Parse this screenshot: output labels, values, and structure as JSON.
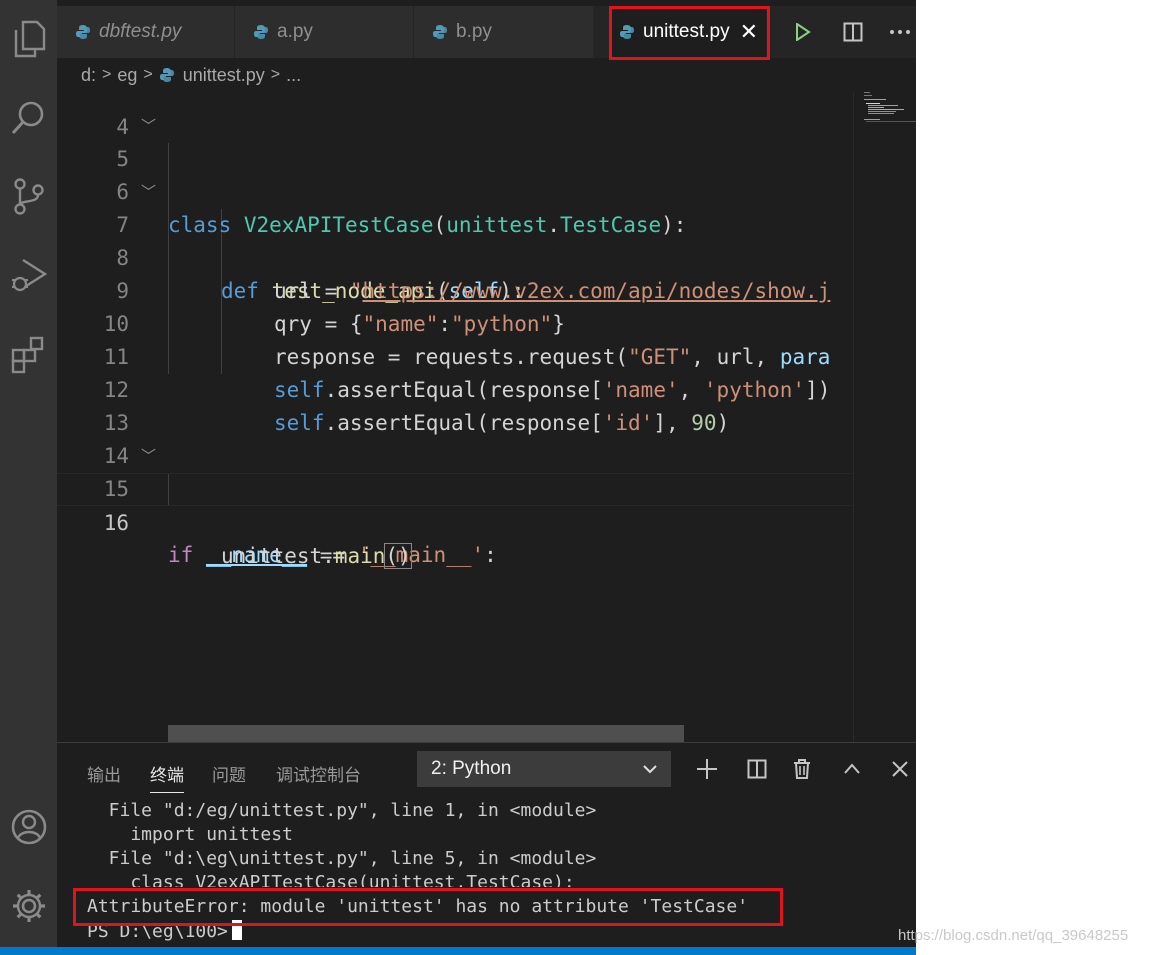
{
  "tabs": [
    {
      "label": "dbftest.py",
      "italic": true
    },
    {
      "label": "a.py",
      "italic": false
    },
    {
      "label": "b.py",
      "italic": false
    },
    {
      "label": "unittest.py",
      "italic": false,
      "active": true
    }
  ],
  "tab_close_glyph": "✕",
  "breadcrumb": {
    "drive": "d:",
    "folder": "eg",
    "file": "unittest.py",
    "more": "..."
  },
  "editor": {
    "partial_line_number": "4",
    "lines": [
      {
        "n": "5"
      },
      {
        "n": "6"
      },
      {
        "n": "7"
      },
      {
        "n": "8"
      },
      {
        "n": "9"
      },
      {
        "n": "10"
      },
      {
        "n": "11"
      },
      {
        "n": "12"
      },
      {
        "n": "13"
      },
      {
        "n": "14"
      },
      {
        "n": "15"
      },
      {
        "n": "16"
      }
    ],
    "code": {
      "l5": [
        "class",
        "V2exAPITestCase",
        "(",
        "unittest",
        ".",
        "TestCase",
        "):"
      ],
      "l7": [
        "def",
        "test_node_api",
        "(",
        "self",
        "):"
      ],
      "l8": [
        "url",
        " = ",
        "\"",
        "https://www.v2ex.com/api/nodes/show.j"
      ],
      "l9": [
        "qry",
        " = {",
        "\"name\"",
        ":",
        "\"python\"",
        "}"
      ],
      "l10": [
        "response",
        " = ",
        "requests",
        ".",
        "request",
        "(",
        "\"GET\"",
        ", url, ",
        "para"
      ],
      "l11": [
        "self",
        ".",
        "assertEqual",
        "(response[",
        "'name'",
        ", ",
        "'python'",
        "])"
      ],
      "l12": [
        "self",
        ".",
        "assertEqual",
        "(response[",
        "'id'",
        "], ",
        "90",
        ")"
      ],
      "l15": [
        "if",
        " ",
        "__name__",
        " == ",
        "'__main__'",
        ":"
      ],
      "l16": [
        "unittest",
        ".",
        "main",
        "()"
      ]
    }
  },
  "panel": {
    "tabs": [
      "输出",
      "终端",
      "问题",
      "调试控制台"
    ],
    "active_tab": "终端",
    "terminal_select": "2: Python",
    "terminal_lines": [
      "  File \"d:/eg/unittest.py\", line 1, in <module>",
      "    import unittest",
      "  File \"d:\\eg\\unittest.py\", line 5, in <module>",
      "    class V2exAPITestCase(unittest.TestCase):",
      "AttributeError: module 'unittest' has no attribute 'TestCase'",
      "PS D:\\eg\\100>"
    ]
  },
  "watermark": "https://blog.csdn.net/qq_39648255",
  "colors": {
    "highlight": "#e0141f",
    "editor_bg": "#1e1e1e",
    "activity_bg": "#333333",
    "status_bar": "#007acc"
  },
  "icons": [
    "explorer-icon",
    "search-icon",
    "source-control-icon",
    "run-debug-icon",
    "extensions-icon",
    "account-icon",
    "settings-gear-icon",
    "python-file-icon",
    "run-icon",
    "split-editor-icon",
    "more-actions-icon",
    "add-terminal-icon",
    "split-terminal-icon",
    "trash-icon",
    "chevron-up-icon",
    "close-icon"
  ]
}
